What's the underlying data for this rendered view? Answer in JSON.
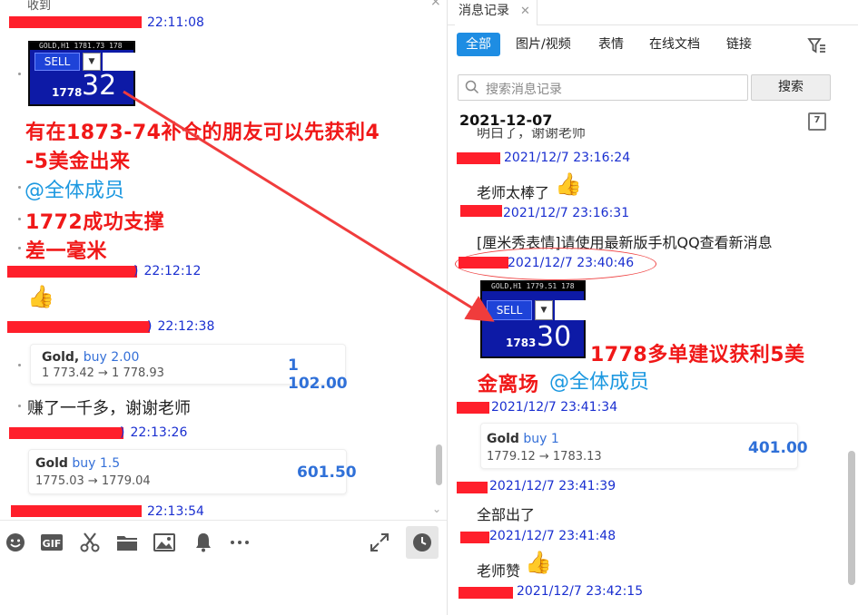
{
  "left": {
    "top_cut_text": "收到",
    "messages": [
      {
        "time": "22:11:08"
      },
      {
        "time": "22:12:12"
      },
      {
        "time": "22:12:38"
      },
      {
        "time": "22:13:26"
      },
      {
        "time": "22:13:54"
      }
    ],
    "sell_card_top": {
      "chart_label": "GOLD,H1 1781.73 178",
      "sell_label": "SELL",
      "small_num": "1778",
      "big_num": "32"
    },
    "announcement": {
      "line1": "有在1873-74补仓的朋友可以先获利4",
      "line2": "-5美金出来",
      "mention": "@全体成员",
      "line3": "1772成功支撑",
      "line4": "差一毫米"
    },
    "trade_card1": {
      "symbol": "Gold,",
      "direction": "buy 2.00",
      "prices": "1 773.42 → 1 778.93",
      "profit": "1 102.00"
    },
    "message_text": "赚了一千多，谢谢老师",
    "trade_card2": {
      "symbol": "Gold",
      "direction": "buy 1.5",
      "prices": "1775.03 → 1779.04",
      "profit": "601.50"
    },
    "toolbar": [
      "emoji-icon",
      "gif-icon",
      "scissors-icon",
      "folder-icon",
      "image-icon",
      "bell-icon",
      "more-icon",
      "expand-icon",
      "history-icon"
    ]
  },
  "right": {
    "tab_title": "消息记录",
    "filter_tabs": [
      "全部",
      "图片/视频",
      "表情",
      "在线文档",
      "链接"
    ],
    "search_placeholder": "搜索消息记录",
    "search_button": "搜索",
    "date": "2021-12-07",
    "calendar_day": "7",
    "cut_text": "明白了，谢谢老师",
    "messages": [
      {
        "time": "2021/12/7 23:16:24",
        "text": "老师太棒了"
      },
      {
        "time": "2021/12/7 23:16:31",
        "text": "[厘米秀表情]请使用最新版手机QQ查看新消息"
      },
      {
        "time": "2021/12/7 23:40:46"
      },
      {
        "time": "2021/12/7 23:41:34"
      },
      {
        "time": "2021/12/7 23:41:39",
        "text": "全部出了"
      },
      {
        "time": "2021/12/7 23:41:48",
        "text": "老师赞"
      },
      {
        "time": "2021/12/7 23:42:15"
      }
    ],
    "sell_card": {
      "chart_label": "GOLD,H1 1779.51 178",
      "sell_label": "SELL",
      "small_num": "1783",
      "big_num": "30"
    },
    "red_text": {
      "line1": "1778多单建议获利5美",
      "line2": "金离场",
      "mention": "@全体成员"
    },
    "trade_card": {
      "symbol": "Gold",
      "direction": "buy 1",
      "prices": "1779.12 → 1783.13",
      "profit": "401.00"
    }
  },
  "colors": {
    "accent": "#1e8de3",
    "timestamp": "#1a2fd0",
    "redact": "#ff1f2b",
    "red_text": "#f01818",
    "mention": "#1c98e0",
    "profit": "#2f70d8"
  }
}
